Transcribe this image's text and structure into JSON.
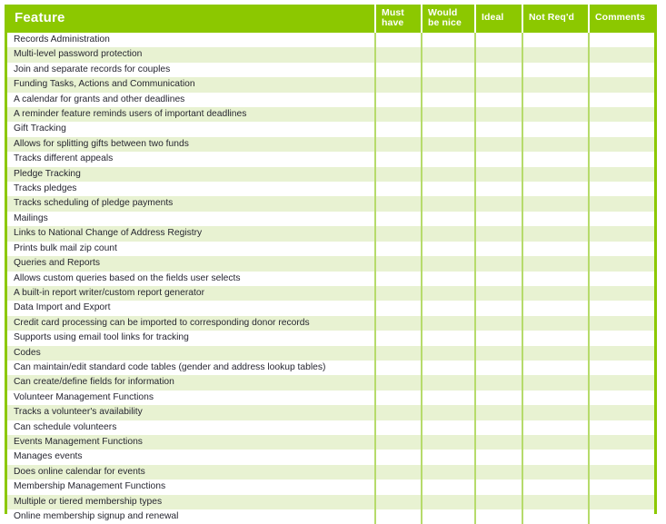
{
  "document": {
    "type": "feature-requirements-checklist",
    "accent_color": "#8CC800",
    "row_alt_color": "#E8F2D2",
    "divider_color": "#B6DB6B",
    "text_color": "#262630"
  },
  "table": {
    "columns": [
      {
        "key": "feature",
        "label": "Feature"
      },
      {
        "key": "must_have",
        "label": "Must have"
      },
      {
        "key": "would_be_nice",
        "label": "Would be nice"
      },
      {
        "key": "ideal",
        "label": "Ideal"
      },
      {
        "key": "not_reqd",
        "label": "Not Req'd"
      },
      {
        "key": "comments",
        "label": "Comments"
      }
    ],
    "rows": [
      {
        "feature": "Records Administration",
        "must_have": "",
        "would_be_nice": "",
        "ideal": "",
        "not_reqd": "",
        "comments": ""
      },
      {
        "feature": "Multi-level password protection",
        "must_have": "",
        "would_be_nice": "",
        "ideal": "",
        "not_reqd": "",
        "comments": ""
      },
      {
        "feature": "Join and separate records for couples",
        "must_have": "",
        "would_be_nice": "",
        "ideal": "",
        "not_reqd": "",
        "comments": ""
      },
      {
        "feature": "Funding Tasks, Actions and Communication",
        "must_have": "",
        "would_be_nice": "",
        "ideal": "",
        "not_reqd": "",
        "comments": ""
      },
      {
        "feature": "A calendar for grants and other deadlines",
        "must_have": "",
        "would_be_nice": "",
        "ideal": "",
        "not_reqd": "",
        "comments": ""
      },
      {
        "feature": "A reminder feature reminds users of important deadlines",
        "must_have": "",
        "would_be_nice": "",
        "ideal": "",
        "not_reqd": "",
        "comments": ""
      },
      {
        "feature": "Gift Tracking",
        "must_have": "",
        "would_be_nice": "",
        "ideal": "",
        "not_reqd": "",
        "comments": ""
      },
      {
        "feature": "Allows for splitting gifts between two funds",
        "must_have": "",
        "would_be_nice": "",
        "ideal": "",
        "not_reqd": "",
        "comments": ""
      },
      {
        "feature": "Tracks different appeals",
        "must_have": "",
        "would_be_nice": "",
        "ideal": "",
        "not_reqd": "",
        "comments": ""
      },
      {
        "feature": "Pledge Tracking",
        "must_have": "",
        "would_be_nice": "",
        "ideal": "",
        "not_reqd": "",
        "comments": ""
      },
      {
        "feature": "Tracks pledges",
        "must_have": "",
        "would_be_nice": "",
        "ideal": "",
        "not_reqd": "",
        "comments": ""
      },
      {
        "feature": "Tracks scheduling of pledge payments",
        "must_have": "",
        "would_be_nice": "",
        "ideal": "",
        "not_reqd": "",
        "comments": ""
      },
      {
        "feature": "Mailings",
        "must_have": "",
        "would_be_nice": "",
        "ideal": "",
        "not_reqd": "",
        "comments": ""
      },
      {
        "feature": "Links to National Change of Address Registry",
        "must_have": "",
        "would_be_nice": "",
        "ideal": "",
        "not_reqd": "",
        "comments": ""
      },
      {
        "feature": "Prints bulk mail zip count",
        "must_have": "",
        "would_be_nice": "",
        "ideal": "",
        "not_reqd": "",
        "comments": ""
      },
      {
        "feature": "Queries and Reports",
        "must_have": "",
        "would_be_nice": "",
        "ideal": "",
        "not_reqd": "",
        "comments": ""
      },
      {
        "feature": "Allows custom queries based on the fields user selects",
        "must_have": "",
        "would_be_nice": "",
        "ideal": "",
        "not_reqd": "",
        "comments": ""
      },
      {
        "feature": "A built-in report writer/custom report generator",
        "must_have": "",
        "would_be_nice": "",
        "ideal": "",
        "not_reqd": "",
        "comments": ""
      },
      {
        "feature": "Data Import and Export",
        "must_have": "",
        "would_be_nice": "",
        "ideal": "",
        "not_reqd": "",
        "comments": ""
      },
      {
        "feature": "Credit card processing can be imported to corresponding donor records",
        "must_have": "",
        "would_be_nice": "",
        "ideal": "",
        "not_reqd": "",
        "comments": ""
      },
      {
        "feature": "Supports using email tool links for tracking",
        "must_have": "",
        "would_be_nice": "",
        "ideal": "",
        "not_reqd": "",
        "comments": ""
      },
      {
        "feature": "Codes",
        "must_have": "",
        "would_be_nice": "",
        "ideal": "",
        "not_reqd": "",
        "comments": ""
      },
      {
        "feature": "Can maintain/edit standard code tables (gender and address lookup tables)",
        "must_have": "",
        "would_be_nice": "",
        "ideal": "",
        "not_reqd": "",
        "comments": ""
      },
      {
        "feature": "Can create/define fields for information",
        "must_have": "",
        "would_be_nice": "",
        "ideal": "",
        "not_reqd": "",
        "comments": ""
      },
      {
        "feature": "Volunteer Management Functions",
        "must_have": "",
        "would_be_nice": "",
        "ideal": "",
        "not_reqd": "",
        "comments": ""
      },
      {
        "feature": "Tracks a volunteer's availability",
        "must_have": "",
        "would_be_nice": "",
        "ideal": "",
        "not_reqd": "",
        "comments": ""
      },
      {
        "feature": "Can schedule volunteers",
        "must_have": "",
        "would_be_nice": "",
        "ideal": "",
        "not_reqd": "",
        "comments": ""
      },
      {
        "feature": "Events Management Functions",
        "must_have": "",
        "would_be_nice": "",
        "ideal": "",
        "not_reqd": "",
        "comments": ""
      },
      {
        "feature": "Manages events",
        "must_have": "",
        "would_be_nice": "",
        "ideal": "",
        "not_reqd": "",
        "comments": ""
      },
      {
        "feature": "Does online calendar for events",
        "must_have": "",
        "would_be_nice": "",
        "ideal": "",
        "not_reqd": "",
        "comments": ""
      },
      {
        "feature": "Membership Management Functions",
        "must_have": "",
        "would_be_nice": "",
        "ideal": "",
        "not_reqd": "",
        "comments": ""
      },
      {
        "feature": "Multiple or tiered membership types",
        "must_have": "",
        "would_be_nice": "",
        "ideal": "",
        "not_reqd": "",
        "comments": ""
      },
      {
        "feature": "Online membership signup and renewal",
        "must_have": "",
        "would_be_nice": "",
        "ideal": "",
        "not_reqd": "",
        "comments": ""
      }
    ]
  }
}
